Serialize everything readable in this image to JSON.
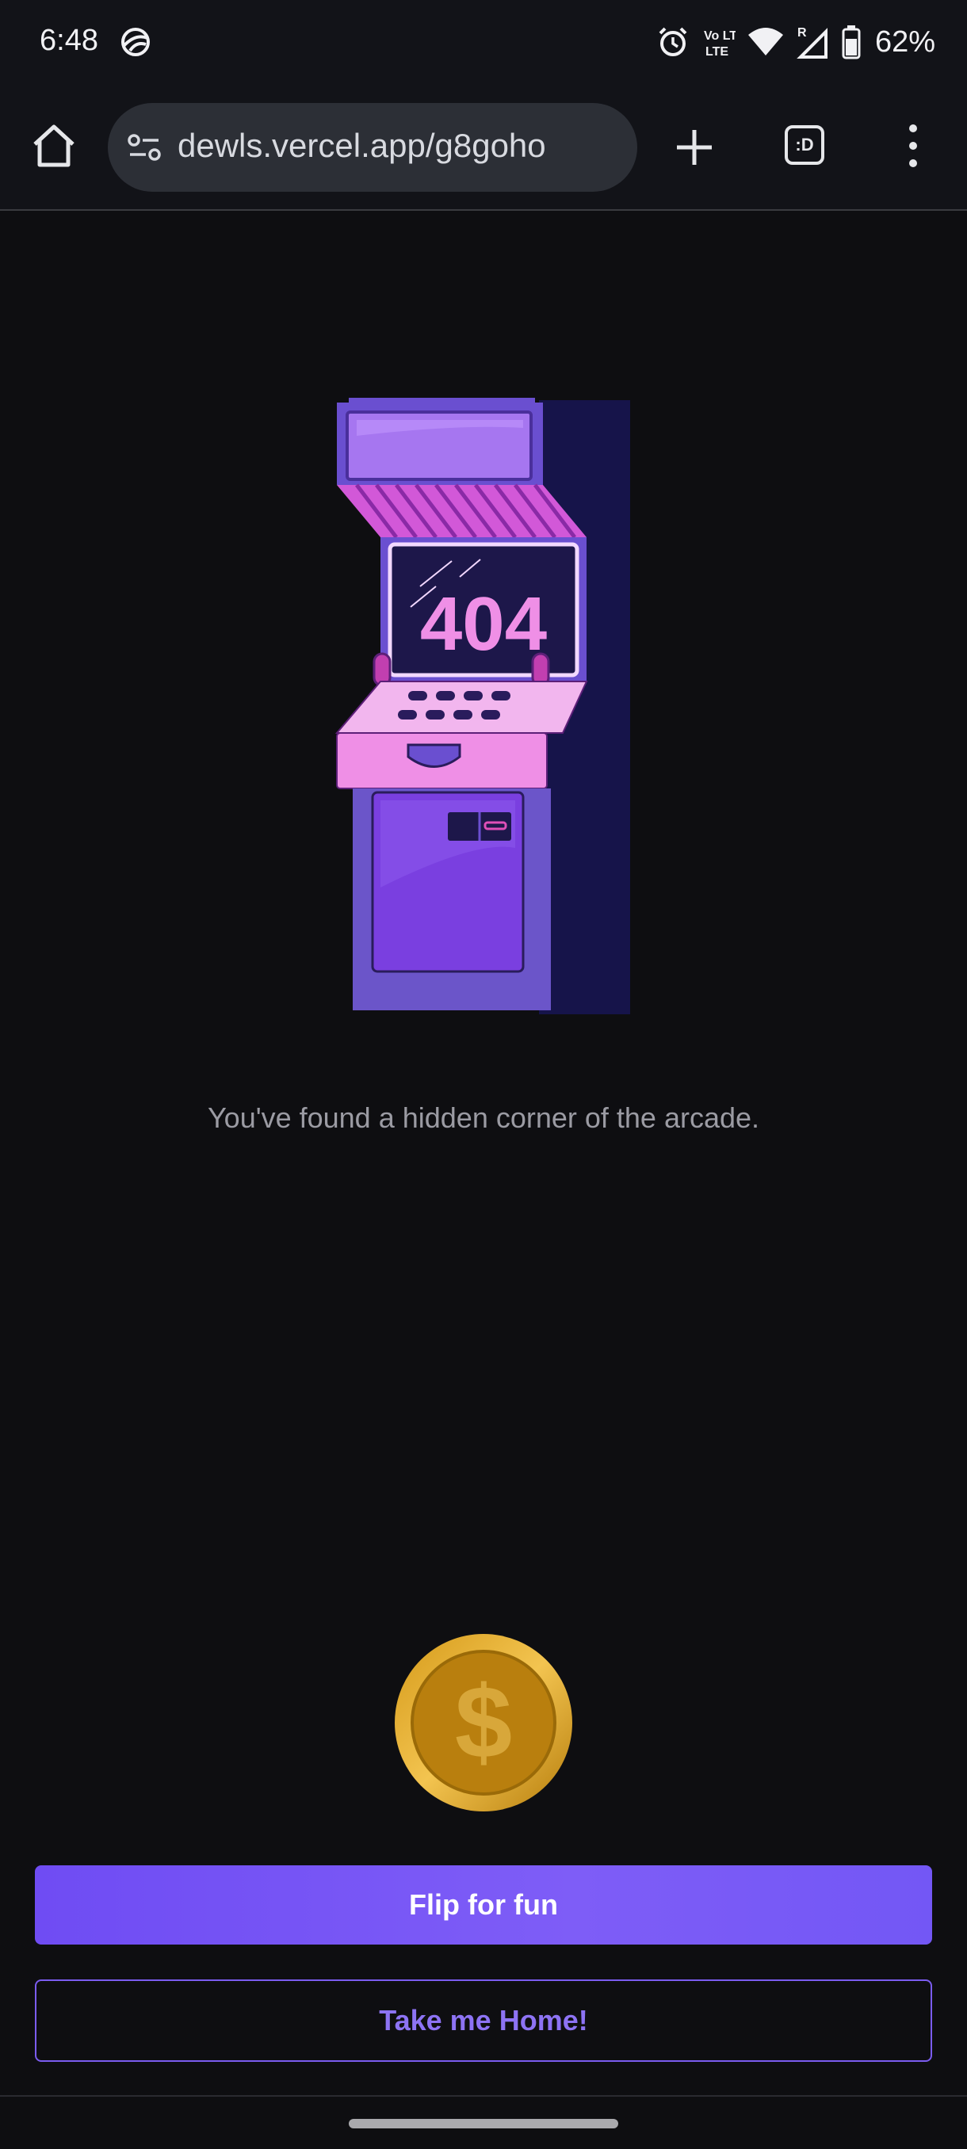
{
  "status_bar": {
    "time": "6:48",
    "network_label": "Vo LTE",
    "signal_label": "R",
    "battery": "62%"
  },
  "browser": {
    "url": "dewls.vercel.app/g8goho",
    "tabs_label": ":D"
  },
  "page": {
    "screen_text": "404",
    "message": "You've found a hidden corner of the arcade.",
    "coin_symbol": "$",
    "flip_button": "Flip for fun",
    "home_button": "Take me Home!"
  },
  "colors": {
    "background": "#0e0e11",
    "accent": "#7357f5",
    "cabinet_purple": "#7a5cd6",
    "cabinet_pink": "#ef8fe6",
    "coin_gold": "#c38a10"
  }
}
